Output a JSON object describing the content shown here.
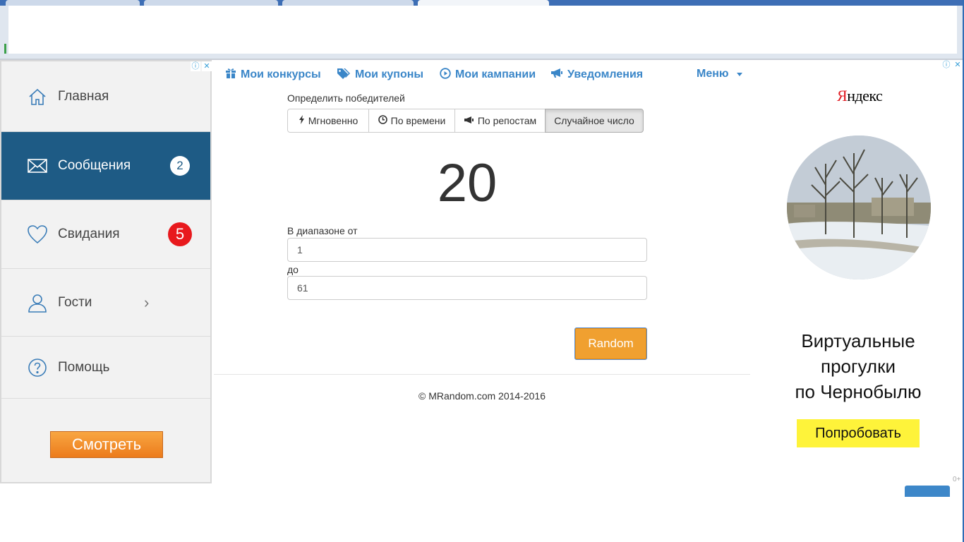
{
  "sidebar": {
    "items": [
      {
        "label": "Главная",
        "icon": "home-icon"
      },
      {
        "label": "Сообщения",
        "icon": "envelope-icon",
        "badge": "2"
      },
      {
        "label": "Свидания",
        "icon": "heart-icon",
        "badge": "5"
      },
      {
        "label": "Гости",
        "icon": "user-icon",
        "chevron": "›"
      },
      {
        "label": "Помощь",
        "icon": "help-icon"
      }
    ],
    "watch_button": "Смотреть"
  },
  "nav": {
    "contests": "Мои конкурсы",
    "coupons": "Мои купоны",
    "campaigns": "Мои кампании",
    "notifications": "Уведомления",
    "menu": "Меню"
  },
  "winner": {
    "title": "Определить победителей",
    "modes": [
      "Мгновенно",
      "По времени",
      "По репостам",
      "Случайное число"
    ],
    "active_mode": "Случайное число",
    "result": "20",
    "range_from_label": "В диапазоне от",
    "range_from_value": "1",
    "range_to_label": "до",
    "range_to_value": "61",
    "random_button": "Random"
  },
  "footer": "© MRandom.com 2014-2016",
  "ad_right": {
    "brand_first": "Я",
    "brand_rest": "ндекс",
    "text_line1": "Виртуальные",
    "text_line2": "прогулки",
    "text_line3": "по Чернобылю",
    "button": "Попробовать",
    "age": "0+"
  },
  "colors": {
    "accent": "#3a86c8",
    "sidebar_active": "#1e5b85",
    "badge_red": "#e8191d",
    "random_button": "#f0a030",
    "ad_button": "#fef33a"
  }
}
